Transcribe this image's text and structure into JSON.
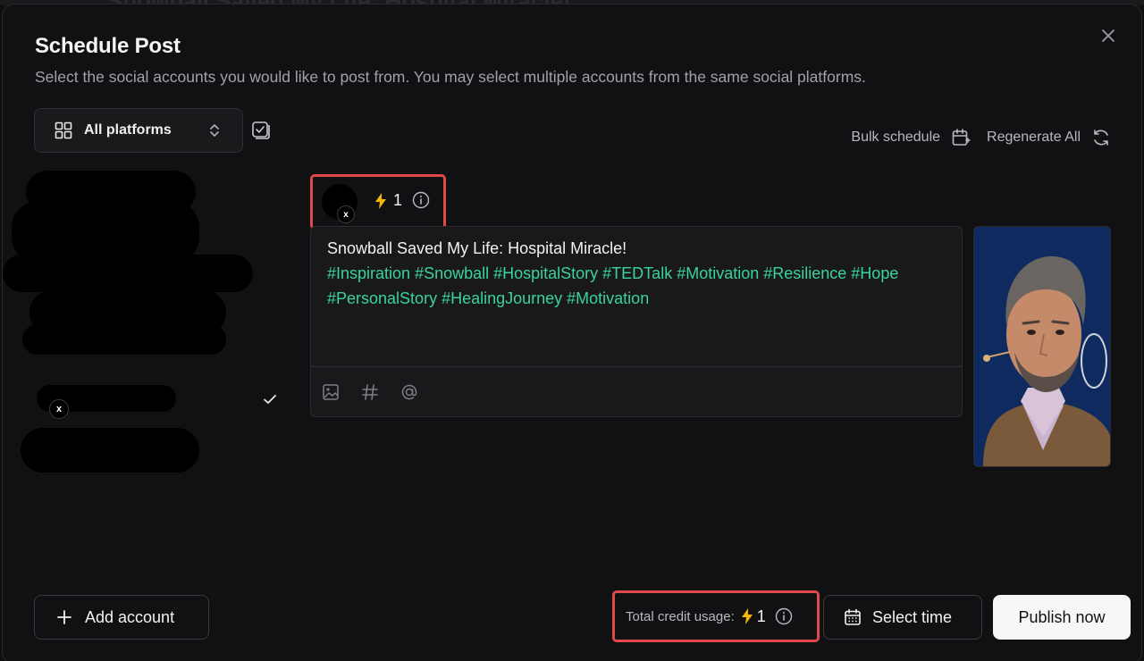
{
  "background_title": "Snowball Saved My Life: Hospital Miracle!",
  "dialog": {
    "title": "Schedule Post",
    "subtitle": "Select the social accounts you would like to post from. You may select multiple accounts from the same social platforms."
  },
  "filter": {
    "platform_label": "All platforms"
  },
  "actions": {
    "bulk_schedule": "Bulk schedule",
    "regenerate_all": "Regenerate All"
  },
  "post": {
    "platform_badge": "x",
    "credit_cost": "1",
    "caption": "Snowball Saved My Life: Hospital Miracle!",
    "hashtags": "#Inspiration #Snowball #HospitalStory #TEDTalk #Motivation #Resilience #Hope #PersonalStory #HealingJourney #Motivation"
  },
  "accounts": {
    "selected_platform_badge": "x"
  },
  "footer": {
    "add_account": "Add account",
    "credit_usage_label": "Total credit usage:",
    "credit_usage_value": "1",
    "select_time": "Select time",
    "publish_now": "Publish now"
  },
  "colors": {
    "accent_hashtag": "#38d39f",
    "highlight_border": "#e0494b",
    "credit_bolt": "#f5b700",
    "primary_button_bg": "#f7f7f8"
  },
  "icons": {
    "close": "close-icon",
    "grid": "grid-icon",
    "chevron": "chevron-updown-icon",
    "select_all": "checkbox-stack-icon",
    "bulk": "calendar-plus-icon",
    "regen": "refresh-icon",
    "bolt": "lightning-icon",
    "info": "info-icon",
    "image": "image-icon",
    "hashtag": "hashtag-icon",
    "mention": "at-icon",
    "plus": "plus-icon",
    "calendar": "calendar-icon"
  }
}
